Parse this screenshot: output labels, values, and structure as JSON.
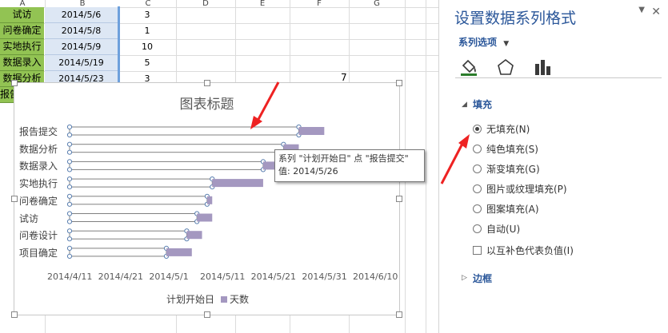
{
  "sheet": {
    "columns": [
      "A",
      "B",
      "C",
      "D",
      "E",
      "F",
      "G"
    ],
    "rows": [
      {
        "task": "试访",
        "date": "2014/5/6",
        "days": "3"
      },
      {
        "task": "问卷确定",
        "date": "2014/5/8",
        "days": "1"
      },
      {
        "task": "实地执行",
        "date": "2014/5/9",
        "days": "10"
      },
      {
        "task": "数据录入",
        "date": "2014/5/19",
        "days": "5"
      },
      {
        "task": "数据分析",
        "date": "2014/5/23",
        "days": "3"
      }
    ],
    "partial_cell": "报告",
    "loose_value": "7"
  },
  "chart": {
    "title": "图表标题",
    "tooltip_line1": "系列 \"计划开始日\" 点 \"报告提交\"",
    "tooltip_line2": "值: 2014/5/26"
  },
  "chart_data": {
    "type": "bar",
    "orientation": "horizontal-stacked",
    "categories": [
      "报告提交",
      "数据分析",
      "数据录入",
      "实地执行",
      "问卷确定",
      "试访",
      "问卷设计",
      "项目确定"
    ],
    "x_ticks": [
      "2014/4/11",
      "2014/4/21",
      "2014/5/1",
      "2014/5/11",
      "2014/5/21",
      "2014/5/31",
      "2014/6/10"
    ],
    "xlim": [
      "2014/4/11",
      "2014/6/10"
    ],
    "series": [
      {
        "name": "计划开始日",
        "values": [
          "2014/5/26",
          "2014/5/23",
          "2014/5/19",
          "2014/5/9",
          "2014/5/8",
          "2014/5/6",
          "2014/5/4",
          "2014/4/30"
        ],
        "fill": "none",
        "color": "#808080"
      },
      {
        "name": "天数",
        "values": [
          5,
          3,
          5,
          10,
          1,
          3,
          3,
          5
        ],
        "color": "#a498c0"
      }
    ],
    "legend_position": "bottom",
    "grid": false
  },
  "panel": {
    "title": "设置数据系列格式",
    "series_options": "系列选项",
    "fill_section": "填充",
    "fill_options": [
      {
        "label": "无填充(N)",
        "selected": true
      },
      {
        "label": "纯色填充(S)",
        "selected": false
      },
      {
        "label": "渐变填充(G)",
        "selected": false
      },
      {
        "label": "图片或纹理填充(P)",
        "selected": false
      },
      {
        "label": "图案填充(A)",
        "selected": false
      },
      {
        "label": "自动(U)",
        "selected": false
      }
    ],
    "invert_label": "以互补色代表负值(I)",
    "border_section": "边框",
    "accent": "#2b579a"
  }
}
